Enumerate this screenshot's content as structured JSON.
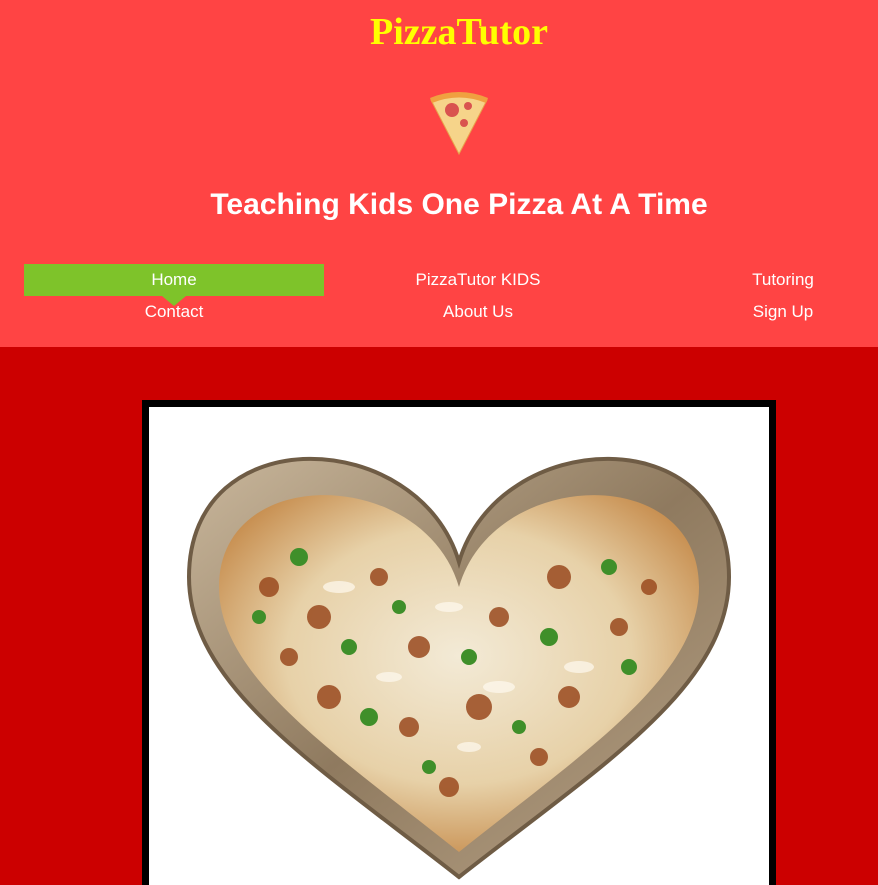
{
  "header": {
    "site_title": "PizzaTutor",
    "logo_icon": "pizza-slice-icon",
    "tagline": "Teaching Kids One Pizza At A Time"
  },
  "nav": {
    "items": [
      {
        "label": "Home",
        "active": true
      },
      {
        "label": "PizzaTutor KIDS",
        "active": false
      },
      {
        "label": "Tutoring",
        "active": false
      },
      {
        "label": "Contact",
        "active": false
      },
      {
        "label": "About Us",
        "active": false
      },
      {
        "label": "Sign Up",
        "active": false
      }
    ]
  },
  "main": {
    "hero_image": "heart-shaped-pizza-photo"
  },
  "colors": {
    "header_bg": "#ff4444",
    "page_bg": "#cc0000",
    "title": "#ffff00",
    "nav_active": "#7ec32a",
    "text": "#ffffff"
  }
}
